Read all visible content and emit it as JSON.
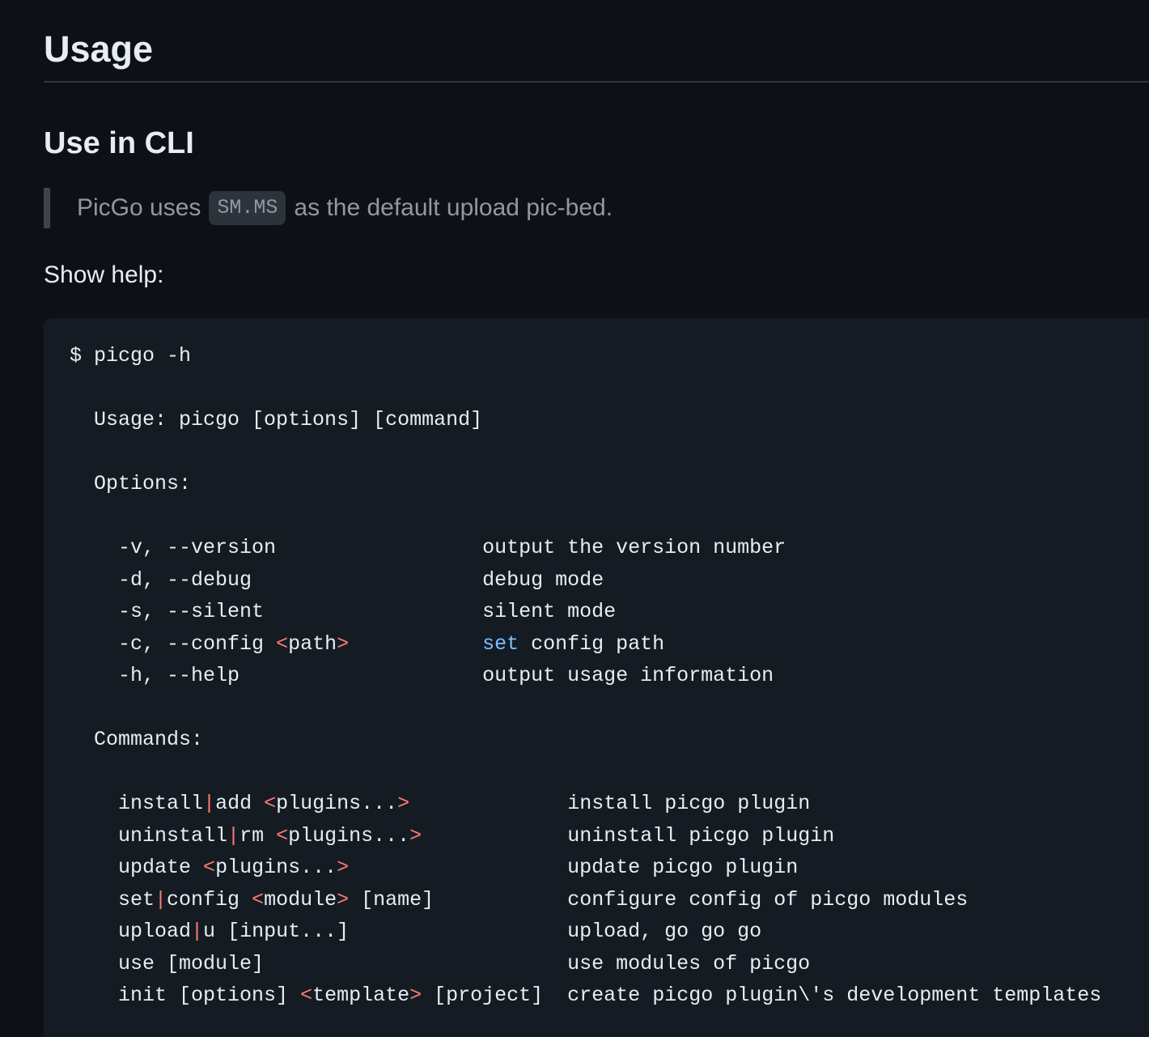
{
  "heading": "Usage",
  "subheading": "Use in CLI",
  "blockquote": {
    "before": "PicGo uses",
    "code": "SM.MS",
    "after": "as the default upload pic-bed."
  },
  "help_label": "Show help:",
  "code": {
    "prompt": "$ picgo -h",
    "usage": "Usage: picgo [options] [command]",
    "options_header": "Options:",
    "options": [
      {
        "flag": "-v, --version",
        "arg": "",
        "desc_kw": "",
        "desc": "output the version number"
      },
      {
        "flag": "-d, --debug",
        "arg": "",
        "desc_kw": "",
        "desc": "debug mode"
      },
      {
        "flag": "-s, --silent",
        "arg": "",
        "desc_kw": "",
        "desc": "silent mode"
      },
      {
        "flag": "-c, --config ",
        "arg": "<path>",
        "desc_kw": "set",
        "desc": " config path"
      },
      {
        "flag": "-h, --help",
        "arg": "",
        "desc_kw": "",
        "desc": "output usage information"
      }
    ],
    "commands_header": "Commands:",
    "commands": [
      {
        "name": "install",
        "alias": "add",
        "args": " <plugins...>",
        "desc": "install picgo plugin"
      },
      {
        "name": "uninstall",
        "alias": "rm",
        "args": " <plugins...>",
        "desc": "uninstall picgo plugin"
      },
      {
        "name": "update",
        "alias": "",
        "args": " <plugins...>",
        "desc": "update picgo plugin"
      },
      {
        "name": "set",
        "alias": "config",
        "args": " <module> [name]",
        "desc": "configure config of picgo modules"
      },
      {
        "name": "upload",
        "alias": "u",
        "args": " [input...]",
        "desc": "upload, go go go"
      },
      {
        "name": "use",
        "alias": "",
        "args": " [module]",
        "desc": "use modules of picgo"
      },
      {
        "name": "init",
        "alias": "",
        "args": " [options] <template> [project]",
        "desc": "create picgo plugin\\'s development templates"
      }
    ]
  },
  "colors": {
    "background": "#0d1117",
    "code_background": "#151b23",
    "text": "#e6edf3",
    "muted": "#9198a1",
    "token_red": "#ff7b72",
    "token_blue": "#79c0ff"
  }
}
